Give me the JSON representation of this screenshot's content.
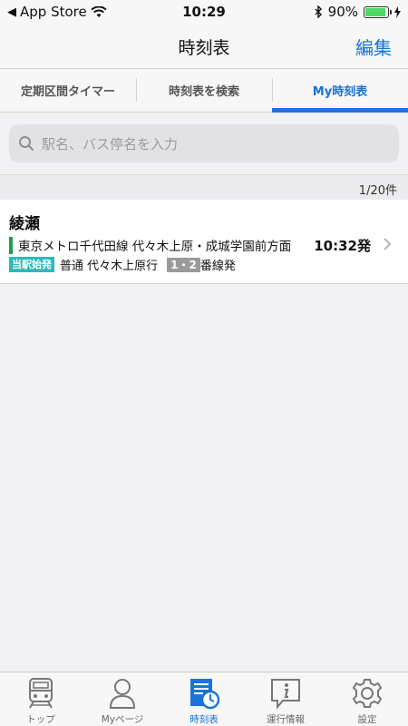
{
  "status_bar": {
    "carrier": "App Store",
    "time": "10:29",
    "battery_percent": "90%",
    "battery_level": 0.9
  },
  "nav": {
    "title": "時刻表",
    "edit_label": "編集"
  },
  "tabs": [
    {
      "label": "定期区間タイマー",
      "active": false
    },
    {
      "label": "時刻表を検索",
      "active": false
    },
    {
      "label": "My時刻表",
      "active": true
    }
  ],
  "search": {
    "placeholder": "駅名、バス停名を入力"
  },
  "list": {
    "count": "1/20件",
    "items": [
      {
        "station": "綾瀬",
        "line": "東京メトロ千代田線 代々木上原・成城学園前方面",
        "line_color": "#1f9a55",
        "departure": "10:32発",
        "origin_badge": "当駅始発",
        "service": "普通 代々木上原行",
        "platform_badge": "1・2",
        "platform_suffix": "番線発"
      }
    ]
  },
  "tab_bar": [
    {
      "label": "トップ",
      "icon": "train-icon",
      "active": false
    },
    {
      "label": "Myページ",
      "icon": "person-icon",
      "active": false
    },
    {
      "label": "時刻表",
      "icon": "timetable-icon",
      "active": true
    },
    {
      "label": "運行情報",
      "icon": "info-icon",
      "active": false
    },
    {
      "label": "設定",
      "icon": "gear-icon",
      "active": false
    }
  ],
  "colors": {
    "accent": "#1a73d8",
    "origin_badge": "#2bb9b9",
    "platform_badge": "#9a9a9a"
  }
}
